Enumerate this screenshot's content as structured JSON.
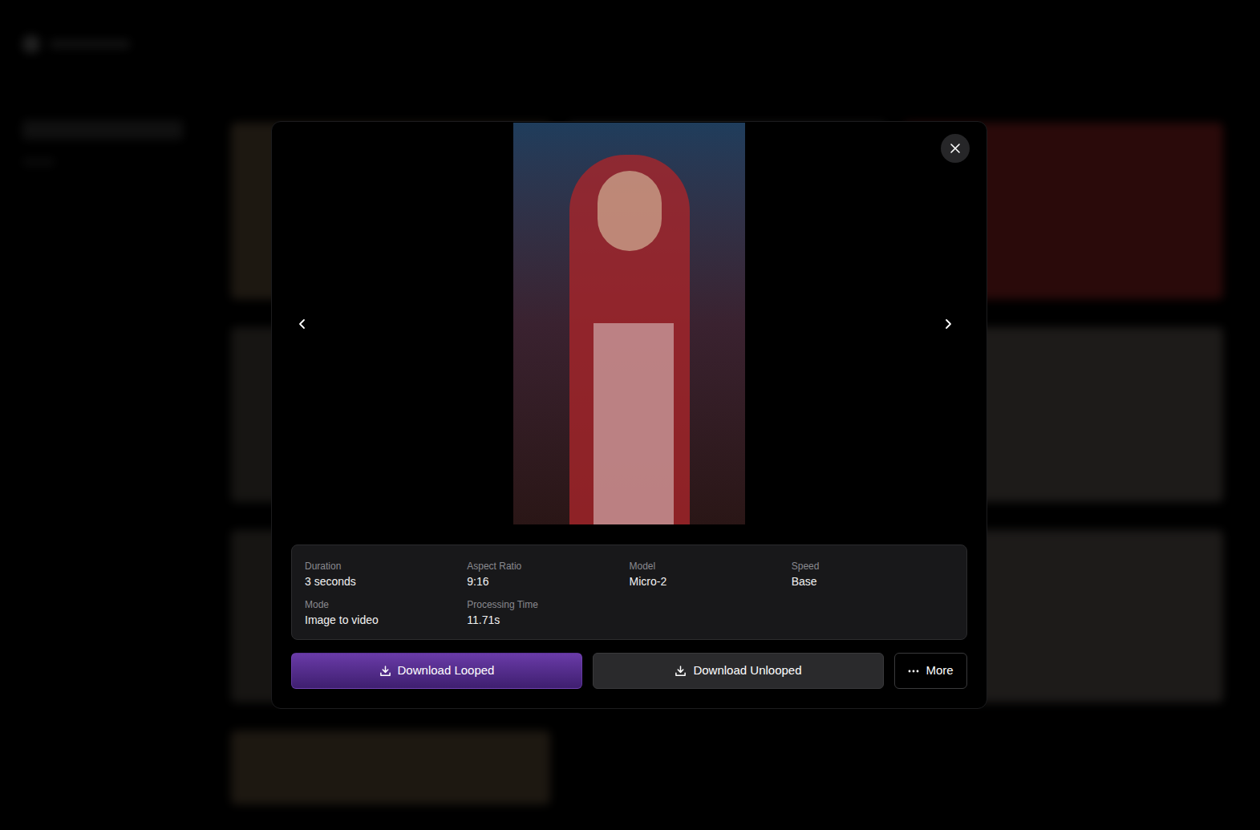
{
  "details": [
    {
      "label": "Duration",
      "value": "3 seconds"
    },
    {
      "label": "Aspect Ratio",
      "value": "9:16"
    },
    {
      "label": "Model",
      "value": "Micro-2"
    },
    {
      "label": "Speed",
      "value": "Base"
    },
    {
      "label": "Mode",
      "value": "Image to video"
    },
    {
      "label": "Processing Time",
      "value": "11.71s"
    }
  ],
  "actions": [
    {
      "label": "Download Looped",
      "kind": "primary"
    },
    {
      "label": "Download Unlooped",
      "kind": "secondary"
    },
    {
      "label": "More",
      "kind": "more"
    }
  ]
}
